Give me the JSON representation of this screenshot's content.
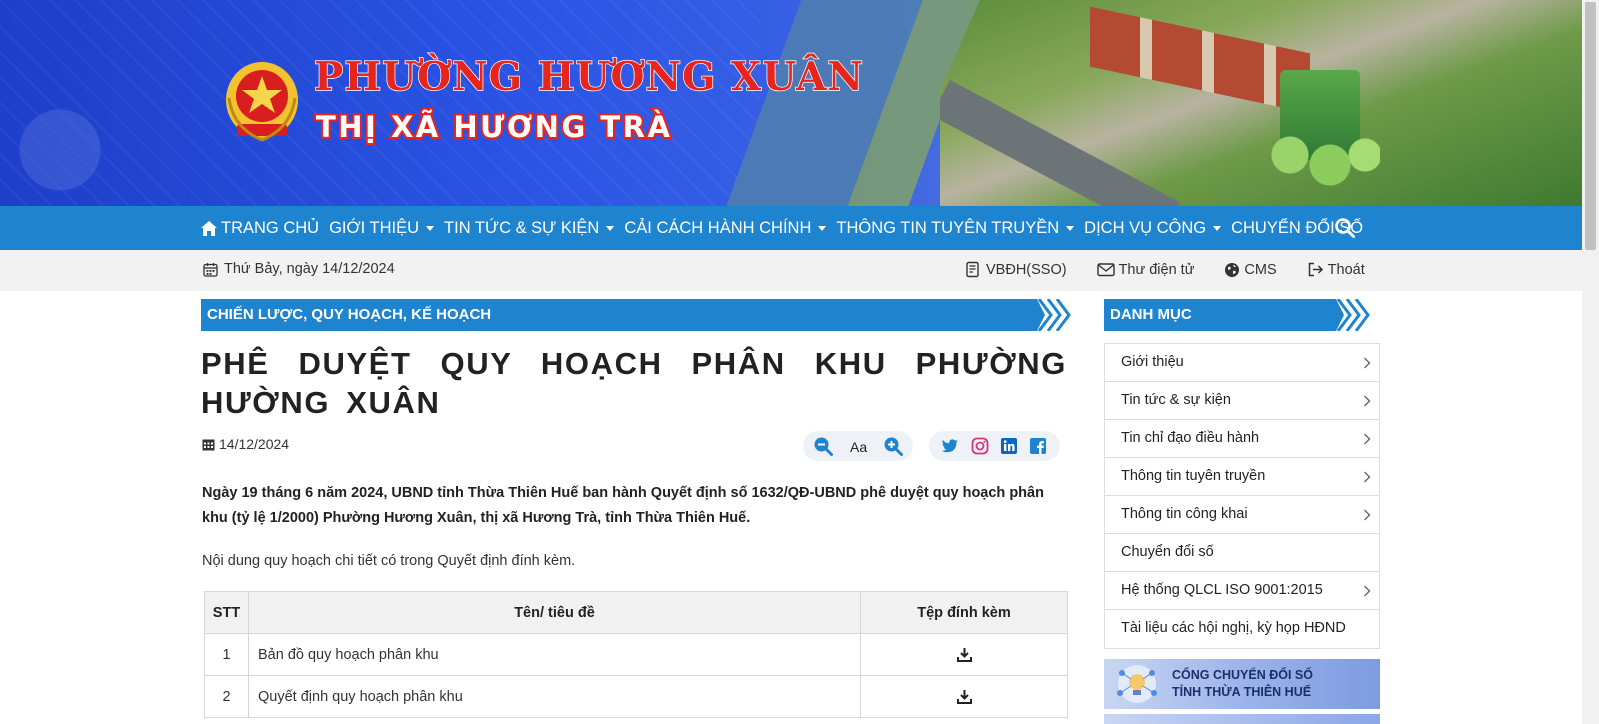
{
  "header": {
    "site_title": "PHƯỜNG HƯƠNG XUÂN",
    "site_subtitle": "THỊ XÃ HƯƠNG TRÀ"
  },
  "nav": {
    "items": [
      {
        "label": "TRANG CHỦ",
        "dropdown": false,
        "icon": "home-icon"
      },
      {
        "label": "GIỚI THIỆU",
        "dropdown": true
      },
      {
        "label": "TIN TỨC & SỰ KIỆN",
        "dropdown": true
      },
      {
        "label": "CẢI CÁCH HÀNH CHÍNH",
        "dropdown": true
      },
      {
        "label": "THÔNG TIN TUYÊN TRUYỀN",
        "dropdown": true
      },
      {
        "label": "DỊCH VỤ CÔNG",
        "dropdown": true
      },
      {
        "label": "CHUYỂN ĐỔI SỐ",
        "dropdown": false
      }
    ],
    "search_icon": "search-icon"
  },
  "topbar": {
    "date": "Thứ Bảy, ngày 14/12/2024",
    "links": [
      {
        "label": "VBĐH(SSO)",
        "icon": "document-icon"
      },
      {
        "label": "Thư điện tử",
        "icon": "mail-icon"
      },
      {
        "label": "CMS",
        "icon": "globe-icon"
      },
      {
        "label": "Thoát",
        "icon": "logout-icon"
      }
    ]
  },
  "article": {
    "category": "CHIẾN LƯỢC, QUY HOẠCH, KẾ HOẠCH",
    "title": "PHÊ DUYỆT QUY HOẠCH PHÂN KHU PHƯỜNG HƯỜNG XUÂN",
    "date": "14/12/2024",
    "font_label": "Aa",
    "lead": "Ngày 19 tháng 6 năm 2024, UBND tỉnh Thừa Thiên Huế ban hành Quyết định số 1632/QĐ-UBND phê duyệt quy hoạch phân khu (tỷ lệ 1/2000) Phường Hương Xuân, thị xã Hương Trà, tỉnh Thừa Thiên Huế.",
    "body": "Nội dung quy hoạch chi tiết có trong Quyết định đính kèm.",
    "table": {
      "headers": [
        "STT",
        "Tên/ tiêu đề",
        "Tệp đính kèm"
      ],
      "rows": [
        {
          "stt": "1",
          "title": "Bản đồ quy hoạch phân khu"
        },
        {
          "stt": "2",
          "title": "Quyết định quy hoạch phân khu"
        }
      ]
    }
  },
  "sidebar": {
    "heading": "DANH MỤC",
    "items": [
      {
        "label": "Giới thiệu",
        "arrow": true
      },
      {
        "label": "Tin tức & sự kiện",
        "arrow": true
      },
      {
        "label": "Tin chỉ đạo điều hành",
        "arrow": true
      },
      {
        "label": "Thông tin tuyên truyền",
        "arrow": true
      },
      {
        "label": "Thông tin công khai",
        "arrow": true
      },
      {
        "label": "Chuyển đổi số",
        "arrow": false
      },
      {
        "label": "Hệ thống QLCL ISO 9001:2015",
        "arrow": true
      },
      {
        "label": "Tài liệu các hội nghị, kỳ họp HĐND",
        "arrow": false
      }
    ],
    "promo_line1": "CỔNG CHUYỂN ĐỔI SỐ",
    "promo_line2": "TỈNH THỪA THIÊN HUẾ"
  },
  "colors": {
    "nav_blue": "#1f84cf",
    "title_red": "#e8251d",
    "banner_blue": "#2c55e6"
  }
}
